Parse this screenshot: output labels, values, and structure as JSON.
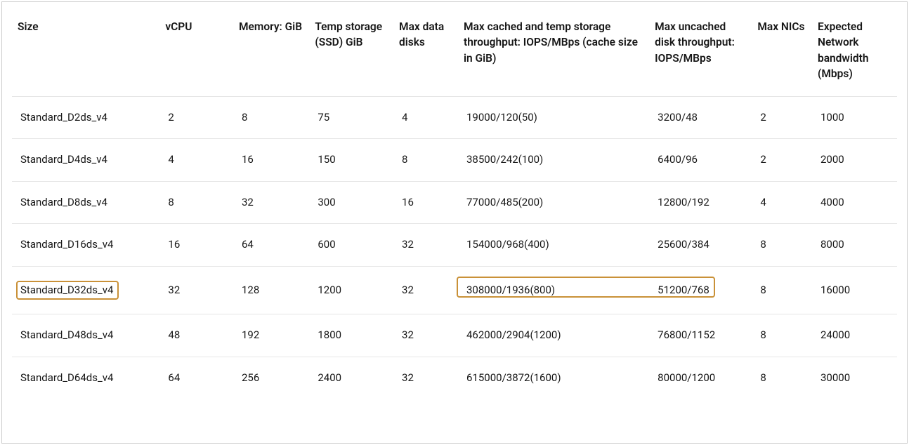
{
  "table": {
    "headers": {
      "size": "Size",
      "vcpu": "vCPU",
      "memory": "Memory: GiB",
      "temp": "Temp storage (SSD) GiB",
      "maxdata": "Max data disks",
      "cached": "Max cached and temp storage throughput: IOPS/MBps (cache size in GiB)",
      "uncached": "Max uncached disk throughput: IOPS/MBps",
      "nics": "Max NICs",
      "bw": "Expected Network bandwidth (Mbps)"
    },
    "rows": [
      {
        "size": "Standard_D2ds_v4",
        "vcpu": "2",
        "memory": "8",
        "temp": "75",
        "maxdata": "4",
        "cached": "19000/120(50)",
        "uncached": "3200/48",
        "nics": "2",
        "bw": "1000"
      },
      {
        "size": "Standard_D4ds_v4",
        "vcpu": "4",
        "memory": "16",
        "temp": "150",
        "maxdata": "8",
        "cached": "38500/242(100)",
        "uncached": "6400/96",
        "nics": "2",
        "bw": "2000"
      },
      {
        "size": "Standard_D8ds_v4",
        "vcpu": "8",
        "memory": "32",
        "temp": "300",
        "maxdata": "16",
        "cached": "77000/485(200)",
        "uncached": "12800/192",
        "nics": "4",
        "bw": "4000"
      },
      {
        "size": "Standard_D16ds_v4",
        "vcpu": "16",
        "memory": "64",
        "temp": "600",
        "maxdata": "32",
        "cached": "154000/968(400)",
        "uncached": "25600/384",
        "nics": "8",
        "bw": "8000"
      },
      {
        "size": "Standard_D32ds_v4",
        "vcpu": "32",
        "memory": "128",
        "temp": "1200",
        "maxdata": "32",
        "cached": "308000/1936(800)",
        "uncached": "51200/768",
        "nics": "8",
        "bw": "16000"
      },
      {
        "size": "Standard_D48ds_v4",
        "vcpu": "48",
        "memory": "192",
        "temp": "1800",
        "maxdata": "32",
        "cached": "462000/2904(1200)",
        "uncached": "76800/1152",
        "nics": "8",
        "bw": "24000"
      },
      {
        "size": "Standard_D64ds_v4",
        "vcpu": "64",
        "memory": "256",
        "temp": "2400",
        "maxdata": "32",
        "cached": "615000/3872(1600)",
        "uncached": "80000/1200",
        "nics": "8",
        "bw": "30000"
      }
    ],
    "highlighted_row_index": 4
  }
}
